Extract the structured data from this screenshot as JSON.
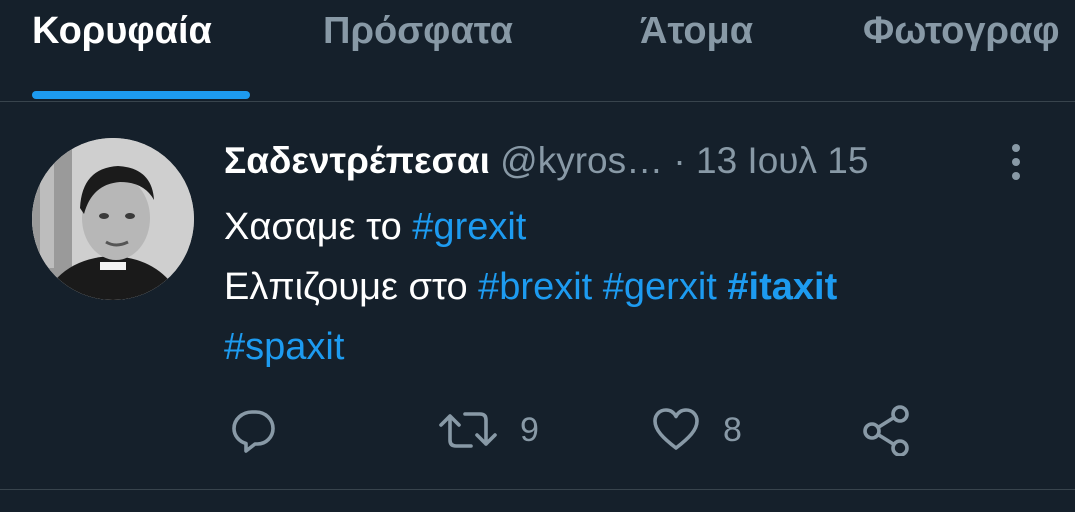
{
  "tabs": [
    {
      "label": "Κορυφαία",
      "active": true
    },
    {
      "label": "Πρόσφατα",
      "active": false
    },
    {
      "label": "Άτομα",
      "active": false
    },
    {
      "label": "Φωτογραφ",
      "active": false
    }
  ],
  "tweet": {
    "display_name": "Σαδεντρέπεσαι",
    "handle": "@kyros…",
    "separator": "·",
    "date": "13 Ιουλ 15",
    "line1_text": "Χασαμε το ",
    "line1_hashtag": "#grexit",
    "line2_text": "Ελπιζουμε στο ",
    "line2_hashtags": [
      "#brexit",
      "#gerxit",
      "#itaxit",
      "#spaxit"
    ],
    "retweets": "9",
    "likes": "8"
  },
  "colors": {
    "background": "#15202b",
    "accent": "#1d9bf0",
    "muted": "#8899a6",
    "divider": "#38444d"
  },
  "icons": [
    "more-vertical-icon",
    "reply-icon",
    "retweet-icon",
    "like-icon",
    "share-icon"
  ]
}
